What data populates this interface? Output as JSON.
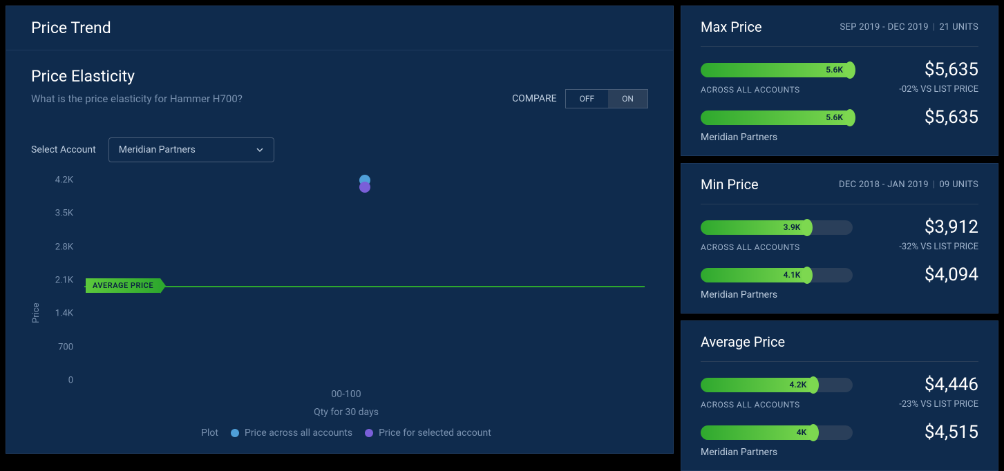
{
  "header": {
    "title": "Price Trend"
  },
  "elasticity": {
    "title": "Price Elasticity",
    "question": "What is the price elasticity for Hammer H700?",
    "compare_label": "COMPARE",
    "off": "OFF",
    "on": "ON",
    "compare_state": "on",
    "select_label": "Select Account",
    "account": "Meridian Partners"
  },
  "chart_data": {
    "type": "scatter",
    "title": "",
    "xlabel": "Qty for 30 days",
    "ylabel": "Price",
    "x_categories": [
      "00-100"
    ],
    "y_ticks": [
      "0",
      "700",
      "1.4K",
      "2.1K",
      "2.8K",
      "3.5K",
      "4.2K"
    ],
    "ylim": [
      0,
      4200
    ],
    "average_line": {
      "label": "AVERAGE PRICE",
      "value": 1950
    },
    "series": [
      {
        "name": "Price across all accounts",
        "color_key": "blue",
        "points": [
          {
            "x": "00-100",
            "y": 4200
          }
        ]
      },
      {
        "name": "Price for selected account",
        "color_key": "purple",
        "points": [
          {
            "x": "00-100",
            "y": 4050
          }
        ]
      }
    ],
    "legend_prefix": "Plot"
  },
  "cards": [
    {
      "title": "Max Price",
      "range": "SEP 2019 - DEC 2019",
      "units": "21 UNITS",
      "rows": [
        {
          "bar_label": "5.6K",
          "bar_pct": 100,
          "value": "$5,635",
          "sub_label": "ACROSS ALL ACCOUNTS",
          "sub_pct": "-02% VS LIST PRICE"
        },
        {
          "bar_label": "5.6K",
          "bar_pct": 100,
          "value": "$5,635",
          "sub_label_plain": "Meridian Partners"
        }
      ]
    },
    {
      "title": "Min Price",
      "range": "DEC 2018 - JAN 2019",
      "units": "09 UNITS",
      "rows": [
        {
          "bar_label": "3.9K",
          "bar_pct": 72,
          "value": "$3,912",
          "sub_label": "ACROSS ALL ACCOUNTS",
          "sub_pct": "-32% VS LIST PRICE"
        },
        {
          "bar_label": "4.1K",
          "bar_pct": 72,
          "value": "$4,094",
          "sub_label_plain": "Meridian Partners"
        }
      ]
    },
    {
      "title": "Average Price",
      "range": "",
      "units": "",
      "rows": [
        {
          "bar_label": "4.2K",
          "bar_pct": 76,
          "value": "$4,446",
          "sub_label": "ACROSS ALL ACCOUNTS",
          "sub_pct": "-23% VS LIST PRICE"
        },
        {
          "bar_label": "4K",
          "bar_pct": 76,
          "value": "$4,515",
          "sub_label_plain": "Meridian Partners"
        }
      ]
    }
  ]
}
